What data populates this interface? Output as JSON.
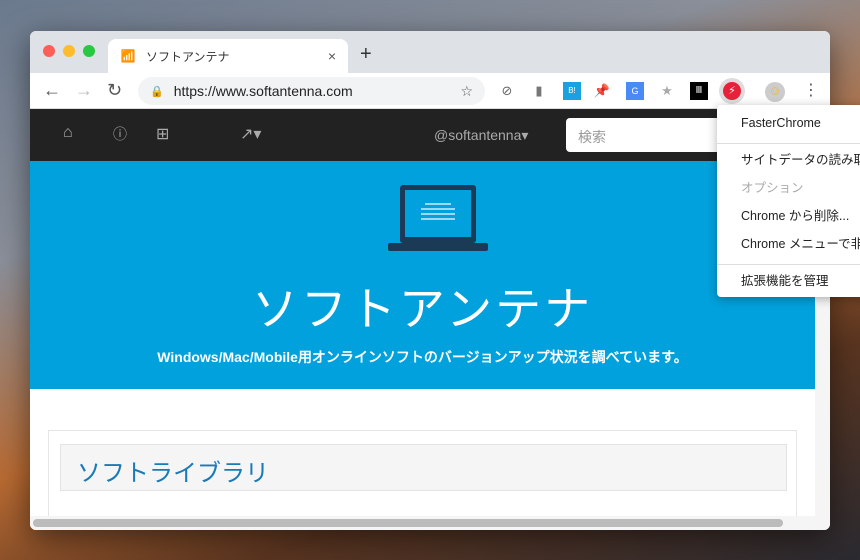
{
  "tab": {
    "title": "ソフトアンテナ",
    "close": "×",
    "new_tab": "+"
  },
  "toolbar": {
    "url": "https://www.softantenna.com",
    "back": "←",
    "forward": "→",
    "reload": "↻",
    "bookmark": "☆",
    "menu": "⋮"
  },
  "site": {
    "account": "@softantenna▾",
    "search_placeholder": "検索",
    "title": "ソフトアンテナ",
    "subtitle": "Windows/Mac/Mobile用オンラインソフトのバージョンアップ状況を調べています。",
    "section_title": "ソフトライブラリ"
  },
  "context_menu": {
    "items": [
      "FasterChrome",
      "サイトデータの読み取り",
      "オプション",
      "Chrome から削除...",
      "Chrome メニューで非表示",
      "拡張機能を管理"
    ]
  },
  "colors": {
    "hero": "#00a1dc",
    "nav": "#222222",
    "accent": "#e8213b"
  }
}
